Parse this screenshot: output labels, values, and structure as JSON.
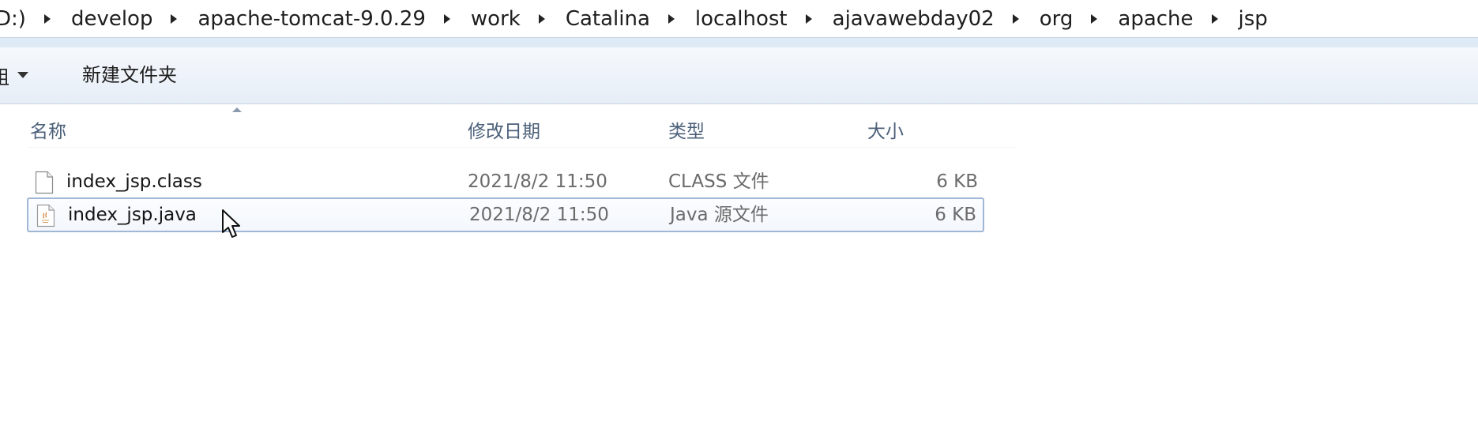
{
  "address_bar": {
    "crumbs": [
      "D:)",
      "develop",
      "apache-tomcat-9.0.29",
      "work",
      "Catalina",
      "localhost",
      "ajavawebday02",
      "org",
      "apache",
      "jsp"
    ]
  },
  "command_bar": {
    "organize_label": "组",
    "new_folder_label": "新建文件夹"
  },
  "file_list": {
    "columns": {
      "name": "名称",
      "date": "修改日期",
      "type": "类型",
      "size": "大小"
    },
    "rows": [
      {
        "name": "index_jsp.class",
        "date": "2021/8/2 11:50",
        "type": "CLASS 文件",
        "size": "6 KB",
        "icon": "blank-file-icon",
        "selected": false
      },
      {
        "name": "index_jsp.java",
        "date": "2021/8/2 11:50",
        "type": "Java 源文件",
        "size": "6 KB",
        "icon": "java-file-icon",
        "selected": true
      }
    ]
  },
  "colors": {
    "selection_border": "#9fb6d4",
    "header_text": "#4c607a",
    "secondary_text": "#6b6b6b"
  }
}
